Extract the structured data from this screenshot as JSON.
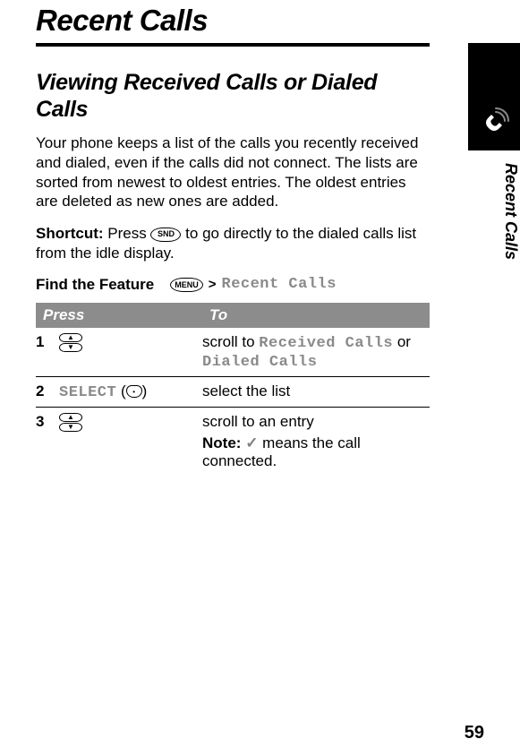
{
  "page": {
    "title": "Recent Calls",
    "subtitle": "Viewing Received Calls or Dialed Calls",
    "intro": "Your phone keeps a list of the calls you recently received and dialed, even if the calls did not connect. The lists are sorted from newest to oldest entries. The oldest entries are deleted as new ones are added.",
    "shortcut_label": "Shortcut:",
    "shortcut_text_before": " Press ",
    "shortcut_key": "SND",
    "shortcut_text_after": " to go directly to the dialed calls list from the idle display.",
    "feature_label": "Find the Feature",
    "feature_menukey": "MENU",
    "feature_chevron": ">",
    "feature_path": "Recent Calls",
    "side_label": "Recent Calls",
    "page_number": "59"
  },
  "table": {
    "headers": {
      "press": "Press",
      "to": "To"
    },
    "rows": [
      {
        "num": "1",
        "press_type": "scroll",
        "to_pre": "scroll to ",
        "to_opt1": "Received Calls",
        "to_mid": " or ",
        "to_opt2": "Dialed Calls"
      },
      {
        "num": "2",
        "press_type": "select",
        "press_label": "SELECT",
        "to": "select the list"
      },
      {
        "num": "3",
        "press_type": "scroll",
        "to": "scroll to an entry",
        "note_label": "Note:",
        "note_check": "✓",
        "note_text": " means the call connected."
      }
    ]
  }
}
